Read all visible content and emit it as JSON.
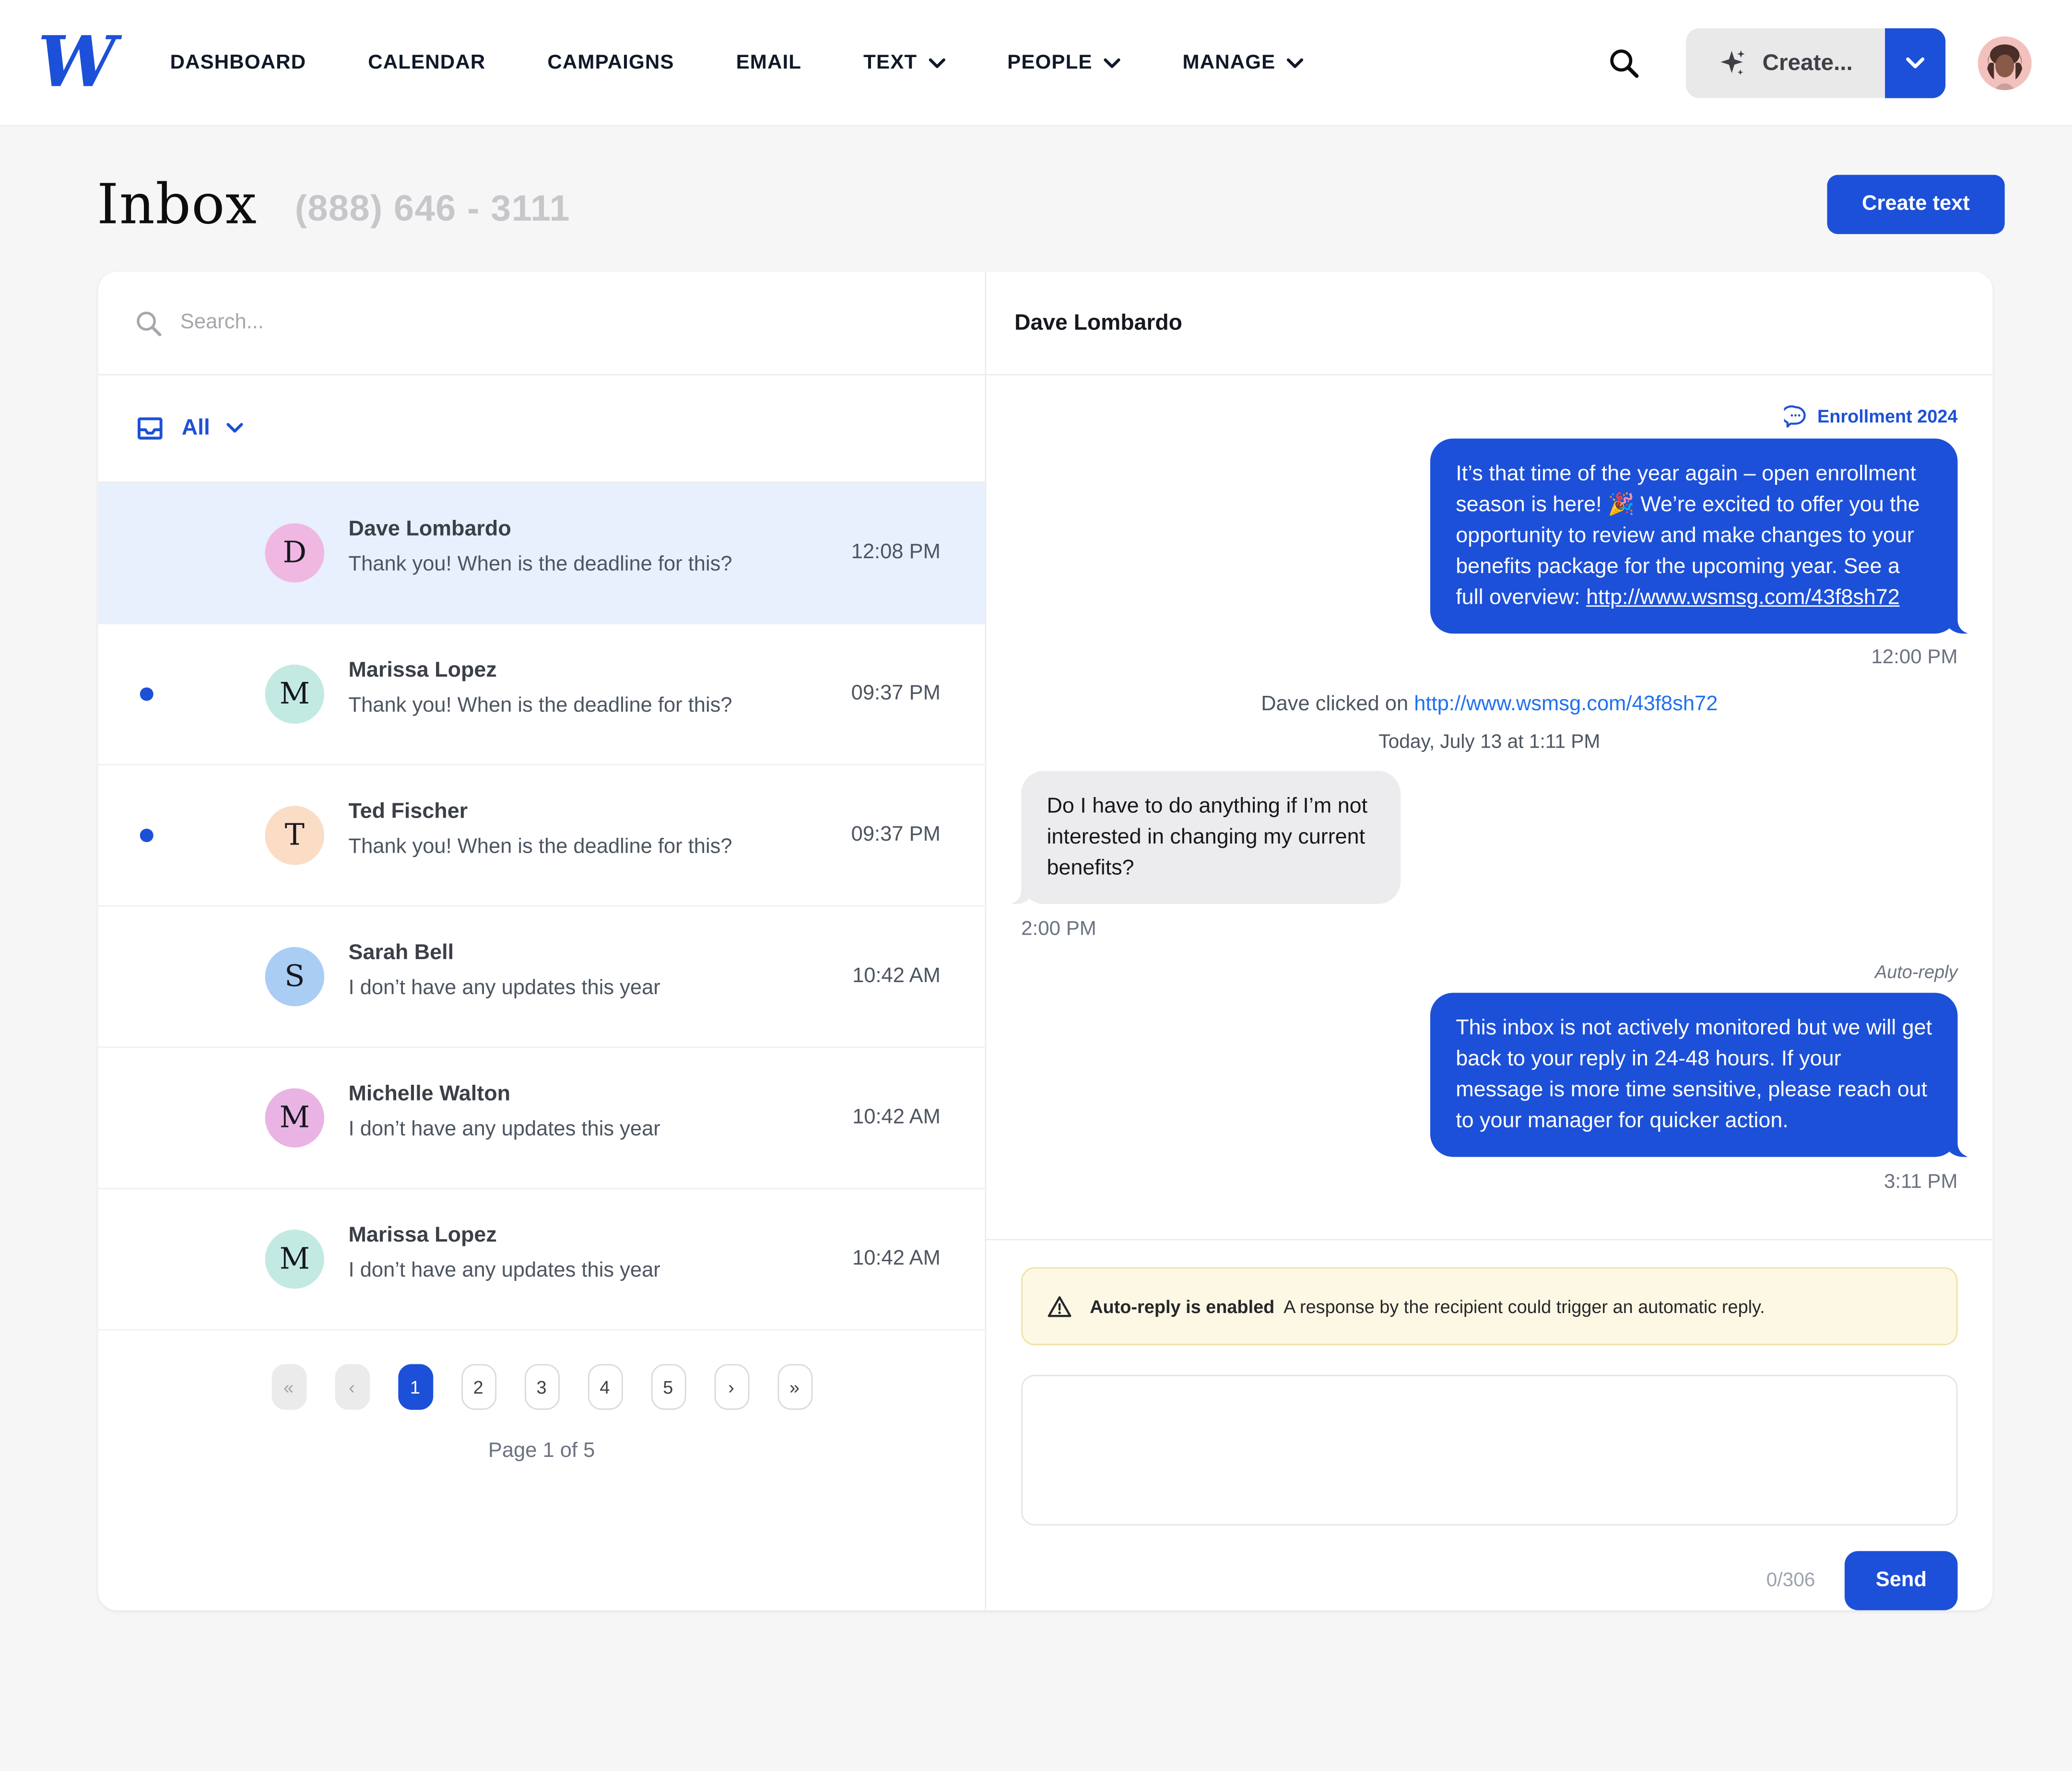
{
  "colors": {
    "accent": "#1d50d8",
    "link_blue": "#2070f0",
    "selected_row_bg": "#e7f0fc",
    "incoming_bubble_bg": "#ececee",
    "banner_bg": "#fdf8e4",
    "banner_border": "#f0e0a2"
  },
  "icons": {
    "logo": "w-logo",
    "search": "magnifier",
    "create_sparkle": "sparkles",
    "chevron": "chevron-down",
    "filter": "inbox-tray",
    "campaign": "speech-bubble",
    "warning": "alert-triangle"
  },
  "nav": {
    "items": [
      {
        "label": "DASHBOARD",
        "chevron": false
      },
      {
        "label": "CALENDAR",
        "chevron": false
      },
      {
        "label": "CAMPAIGNS",
        "chevron": false
      },
      {
        "label": "EMAIL",
        "chevron": false
      },
      {
        "label": "TEXT",
        "chevron": true
      },
      {
        "label": "PEOPLE",
        "chevron": true
      },
      {
        "label": "MANAGE",
        "chevron": true
      }
    ],
    "create_label": "Create...",
    "avatar_alt": "user-avatar"
  },
  "page": {
    "title": "Inbox",
    "phone": "(888) 646 - 3111",
    "create_text_label": "Create text"
  },
  "list": {
    "search_placeholder": "Search...",
    "filter_label": "All",
    "conversations": [
      {
        "initial": "D",
        "avatar_color": "#f0b7e2",
        "name": "Dave Lombardo",
        "preview": "Thank you! When is the deadline for this?",
        "time": "12:08 PM",
        "unread": false,
        "selected": true
      },
      {
        "initial": "M",
        "avatar_color": "#c3eae2",
        "name": "Marissa Lopez",
        "preview": "Thank you! When is the deadline for this?",
        "time": "09:37 PM",
        "unread": true,
        "selected": false
      },
      {
        "initial": "T",
        "avatar_color": "#fbdcc5",
        "name": "Ted Fischer",
        "preview": "Thank you! When is the deadline for this?",
        "time": "09:37 PM",
        "unread": true,
        "selected": false
      },
      {
        "initial": "S",
        "avatar_color": "#aacdf4",
        "name": "Sarah Bell",
        "preview": "I don’t have any updates this year",
        "time": "10:42 AM",
        "unread": false,
        "selected": false
      },
      {
        "initial": "M",
        "avatar_color": "#e9b4e4",
        "name": "Michelle Walton",
        "preview": "I don’t have any updates this year",
        "time": "10:42 AM",
        "unread": false,
        "selected": false
      },
      {
        "initial": "M",
        "avatar_color": "#c3eae2",
        "name": "Marissa Lopez",
        "preview": "I don’t have any updates this year",
        "time": "10:42 AM",
        "unread": false,
        "selected": false
      }
    ],
    "pagination": {
      "items": [
        {
          "label": "«",
          "state": "disabled"
        },
        {
          "label": "‹",
          "state": "disabled"
        },
        {
          "label": "1",
          "state": "active"
        },
        {
          "label": "2",
          "state": "normal"
        },
        {
          "label": "3",
          "state": "normal"
        },
        {
          "label": "4",
          "state": "normal"
        },
        {
          "label": "5",
          "state": "normal"
        },
        {
          "label": "›",
          "state": "normal"
        },
        {
          "label": "»",
          "state": "normal"
        }
      ],
      "page_label": "Page 1 of 5"
    }
  },
  "thread": {
    "contact_name": "Dave Lombardo",
    "campaign_tag": "Enrollment 2024",
    "msg1_text": "It’s that time of the year again – open enrollment season is here! 🎉 We’re excited to offer you the opportunity to review and make changes to your benefits package for the upcoming year. See a full overview: ",
    "msg1_link": "http://www.wsmsg.com/43f8sh72",
    "msg1_time": "12:00 PM",
    "event_prefix": "Dave clicked on ",
    "event_link": "http://www.wsmsg.com/43f8sh72",
    "date_divider": "Today, July 13 at 1:11 PM",
    "msg2_text": "Do I have to do anything if I’m not interested in changing my current benefits?",
    "msg2_time": "2:00 PM",
    "autoreply_label": "Auto-reply",
    "msg3_text": "This inbox is not actively monitored but we will get back to your reply in 24-48 hours. If your message is more time sensitive, please reach out to your manager for quicker action.",
    "msg3_time": "3:11 PM",
    "banner_bold": "Auto-reply is enabled",
    "banner_text": "A response by the recipient could trigger an automatic reply.",
    "composer_value": "",
    "char_count": "0/306",
    "send_label": "Send"
  }
}
